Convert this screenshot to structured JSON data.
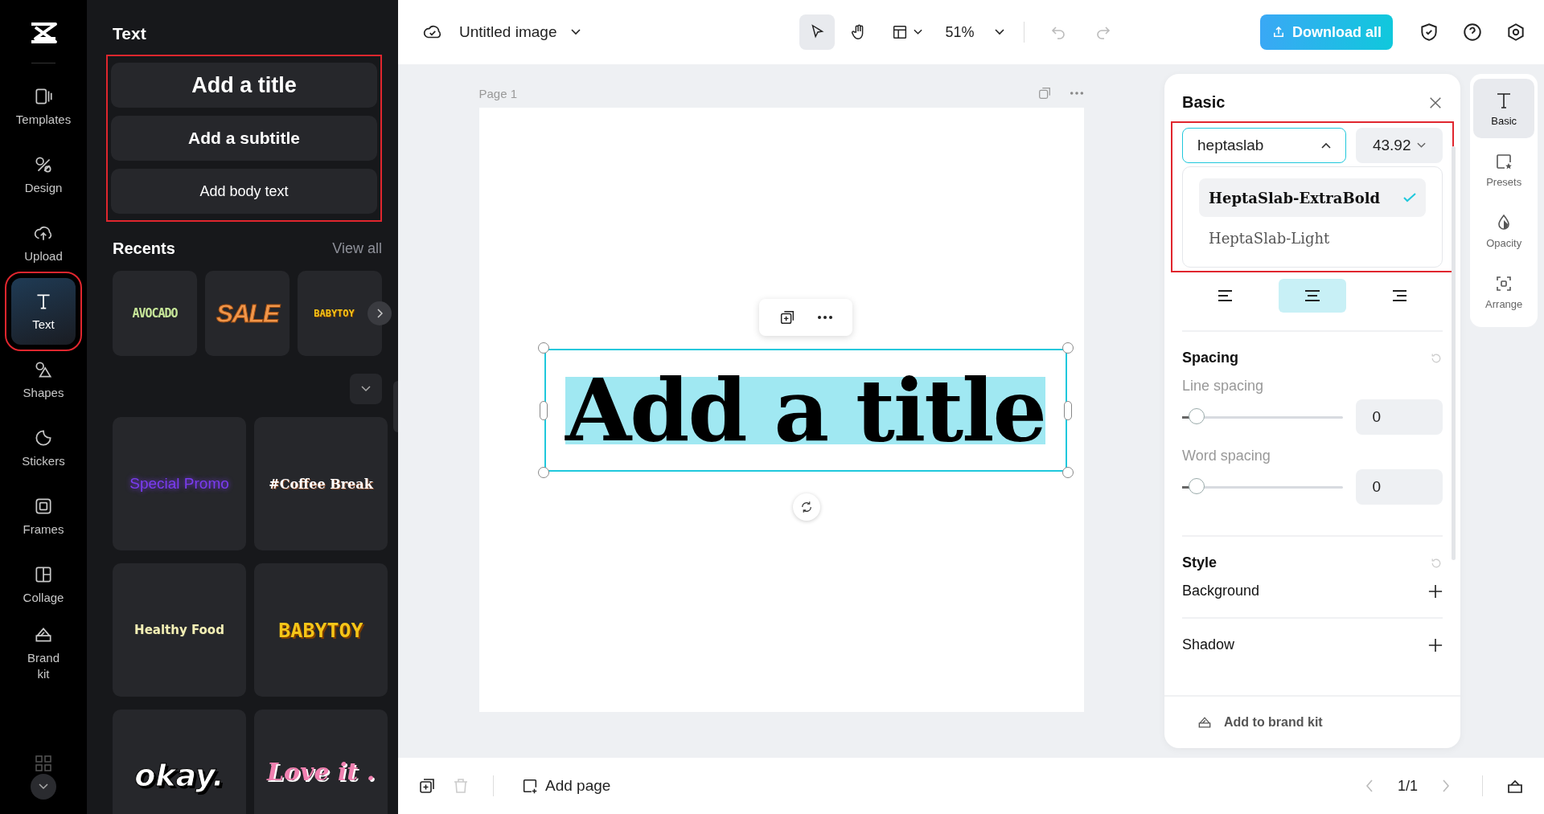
{
  "rail": {
    "items": [
      {
        "label": "Templates",
        "kind": "templates",
        "selected": false
      },
      {
        "label": "Design",
        "kind": "design",
        "selected": false
      },
      {
        "label": "Upload",
        "kind": "upload",
        "selected": false
      },
      {
        "label": "Text",
        "kind": "text",
        "selected": true
      },
      {
        "label": "Shapes",
        "kind": "shapes",
        "selected": false
      },
      {
        "label": "Stickers",
        "kind": "stickers",
        "selected": false
      },
      {
        "label": "Frames",
        "kind": "frames",
        "selected": false
      },
      {
        "label": "Collage",
        "kind": "collage",
        "selected": false
      },
      {
        "label": "Brand kit",
        "kind": "brand",
        "selected": false
      }
    ]
  },
  "text_panel": {
    "title": "Text",
    "quick_add": [
      {
        "label": "Add a title",
        "kind": "title"
      },
      {
        "label": "Add a subtitle",
        "kind": "subtitle"
      },
      {
        "label": "Add body text",
        "kind": "body"
      }
    ],
    "recents": {
      "heading": "Recents",
      "link": "View all",
      "items": [
        {
          "label": "AVOCADO",
          "kind": "avocado",
          "color": "#c8e89a"
        },
        {
          "label": "SALE",
          "kind": "sale",
          "color": "#f0964a"
        },
        {
          "label": "BABYTOY",
          "kind": "toy",
          "color": "#f5c518"
        }
      ]
    },
    "styles": [
      {
        "label": "Special Promo",
        "kind": "neon",
        "color": "#7b3cf0"
      },
      {
        "label": "#Coffee Break",
        "kind": "coffee",
        "color": "#ffffff"
      },
      {
        "label": "Healthy Food",
        "kind": "healthy",
        "color": "#f3efb5"
      },
      {
        "label": "BABYTOY",
        "kind": "toy",
        "color": "#f5c518"
      },
      {
        "label": "okay.",
        "kind": "okay",
        "color": "#ffffff"
      },
      {
        "label": "Love it .",
        "kind": "love",
        "color": "#f080b0"
      }
    ]
  },
  "top_bar": {
    "document_title": "Untitled image",
    "tools": [
      {
        "kind": "select",
        "selected": true
      },
      {
        "kind": "hand",
        "selected": false
      }
    ],
    "zoom": "51%",
    "download": "Download all"
  },
  "canvas": {
    "page_label": "Page 1",
    "text": "Add a title"
  },
  "properties": {
    "title": "Basic",
    "font": "heptaslab",
    "size": "43.92",
    "font_options": [
      {
        "label": "HeptaSlab-ExtraBold",
        "kind": "bold",
        "selected": true
      },
      {
        "label": "HeptaSlab-Light",
        "kind": "light",
        "selected": false
      }
    ],
    "align": [
      {
        "kind": "left",
        "selected": false
      },
      {
        "kind": "center",
        "selected": true
      },
      {
        "kind": "right",
        "selected": false
      }
    ],
    "spacing": {
      "heading": "Spacing",
      "sliders": [
        {
          "label": "Line spacing",
          "level": 0.05,
          "value": "0"
        },
        {
          "label": "Word spacing",
          "level": 0.05,
          "value": "0"
        }
      ]
    },
    "style": {
      "heading": "Style",
      "rows": [
        "Background",
        "Shadow"
      ]
    },
    "brand": "Add to brand kit"
  },
  "side_tabs": [
    {
      "label": "Basic",
      "kind": "basic",
      "selected": true
    },
    {
      "label": "Presets",
      "kind": "presets",
      "selected": false
    },
    {
      "label": "Opacity",
      "kind": "opacity",
      "selected": false
    },
    {
      "label": "Arrange",
      "kind": "arrange",
      "selected": false
    }
  ],
  "bottom_bar": {
    "add_page": "Add page",
    "pages": "1/1"
  }
}
